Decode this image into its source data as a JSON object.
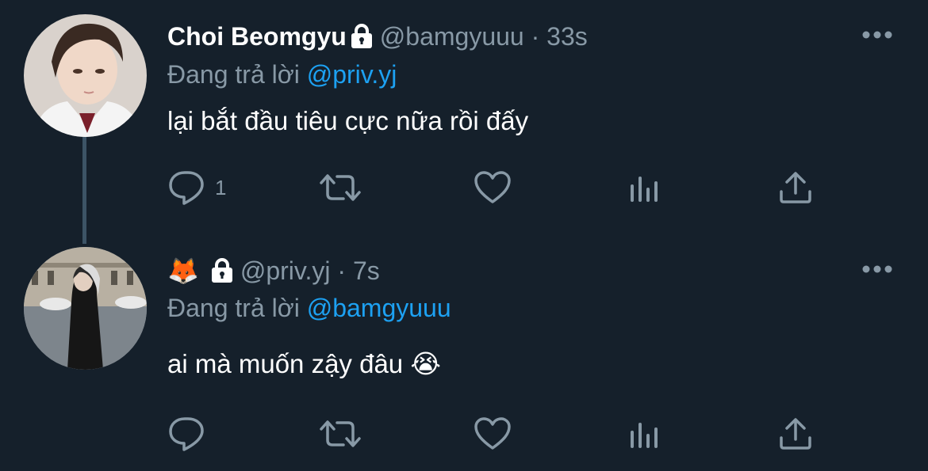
{
  "tweets": [
    {
      "display_name": "Choi Beomgyu",
      "handle": "@bamgyuuu",
      "separator": "·",
      "time": "33s",
      "replying_prefix": "Đang trả lời",
      "replying_to": "@priv.yj",
      "text": "lại bắt đầu tiêu cực nữa rồi đấy",
      "reply_count": "1",
      "locked": true
    },
    {
      "display_name": "🦊",
      "handle": "@priv.yj",
      "separator": "·",
      "time": "7s",
      "replying_prefix": "Đang trả lời",
      "replying_to": "@bamgyuuu",
      "text": "ai mà muốn zậy đâu 😭",
      "reply_count": "",
      "locked": true
    }
  ],
  "icons": {
    "lock": "lock-icon",
    "more": "more-icon",
    "reply": "reply-icon",
    "retweet": "retweet-icon",
    "like": "heart-icon",
    "analytics": "analytics-icon",
    "share": "share-icon"
  },
  "colors": {
    "background": "#15202b",
    "secondary_text": "#8899a6",
    "link": "#1da1f2",
    "thread_line": "#3d5466"
  }
}
